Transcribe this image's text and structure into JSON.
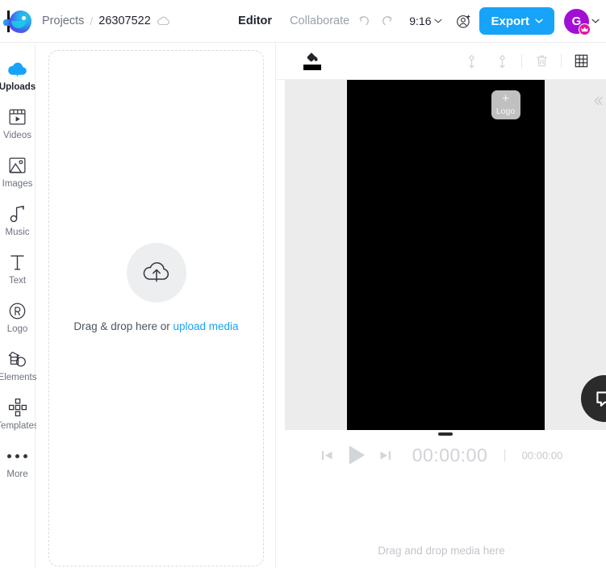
{
  "header": {
    "logo_icon": "brand-bird-logo",
    "breadcrumb": {
      "projects": "Projects",
      "separator": "/",
      "project_id": "26307522",
      "cloud_icon": "cloud-saved-icon"
    },
    "tabs": [
      {
        "label": "Editor",
        "active": true
      },
      {
        "label": "Collaborate",
        "active": false
      }
    ],
    "undo_icon": "undo-icon",
    "redo_icon": "redo-icon",
    "aspect_ratio": "9:16",
    "aspect_chevron_icon": "chevron-down-icon",
    "add_user_icon": "add-user-icon",
    "export_label": "Export",
    "export_chevron_icon": "chevron-down-icon",
    "export_color": "#17a3f7",
    "avatar_initial": "G",
    "avatar_color": "#a10fd4",
    "avatar_badge_icon": "crown-icon",
    "avatar_chevron_icon": "chevron-down-icon"
  },
  "sidebar": {
    "items": [
      {
        "label": "Uploads",
        "icon": "cloud-upload-icon",
        "active": true
      },
      {
        "label": "Videos",
        "icon": "video-clip-icon",
        "active": false
      },
      {
        "label": "Images",
        "icon": "image-icon",
        "active": false
      },
      {
        "label": "Music",
        "icon": "music-note-icon",
        "active": false
      },
      {
        "label": "Text",
        "icon": "text-t-icon",
        "active": false
      },
      {
        "label": "Logo",
        "icon": "registered-r-icon",
        "active": false
      },
      {
        "label": "Elements",
        "icon": "shapes-icon",
        "active": false
      },
      {
        "label": "Templates",
        "icon": "templates-grid-icon",
        "active": false
      },
      {
        "label": "More",
        "icon": "more-dots-icon",
        "active": false
      }
    ],
    "active_accent": "#17a3f7"
  },
  "uploads_panel": {
    "upload_icon": "cloud-upload-icon",
    "drop_text": "Drag & drop here or",
    "link_text": "upload media"
  },
  "canvas_toolbar": {
    "bucket_icon": "paint-bucket-icon",
    "bucket_swatch_color": "#000000",
    "bring_forward_icon": "bring-to-front-icon",
    "send_backward_icon": "send-to-back-icon",
    "delete_icon": "trash-icon",
    "grid_icon": "grid-layout-icon"
  },
  "stage": {
    "background": "#ececec",
    "video_background": "#000000",
    "logo_placeholder": {
      "plus": "+",
      "label": "Logo"
    },
    "collapse_icon": "chevrons-left-icon",
    "resize_handle_icon": "drag-handle-icon"
  },
  "playback": {
    "skip_back_icon": "skip-previous-icon",
    "play_icon": "play-icon",
    "skip_forward_icon": "skip-next-icon",
    "current_time": "00:00:00",
    "separator": "|",
    "total_time": "00:00:00"
  },
  "timeline": {
    "empty_text": "Drag and drop media here"
  },
  "chat_widget": {
    "icon": "chat-bubble-icon",
    "color": "#2b2b2b"
  }
}
